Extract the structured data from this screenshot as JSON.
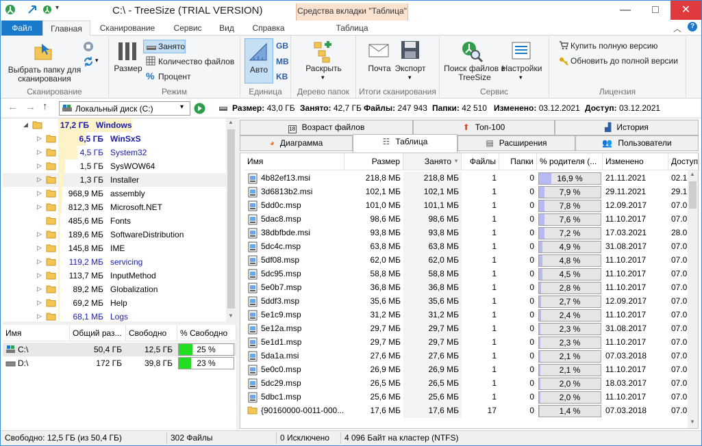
{
  "window": {
    "title": "C:\\ - TreeSize  (TRIAL VERSION)",
    "context_tab_title": "Средства вкладки \"Таблица\"",
    "minimize": "—",
    "maximize": "□",
    "close": "✕"
  },
  "ribbon_tabs": [
    "Файл",
    "Главная",
    "Сканирование",
    "Сервис",
    "Вид",
    "Справка",
    "Таблица"
  ],
  "ribbon": {
    "scan_folder": "Выбрать папку для сканирования",
    "group_scan": "Сканирование",
    "size": "Размер",
    "occupied": "Занято",
    "file_count": "Количество файлов",
    "percent": "Процент",
    "group_mode": "Режим",
    "auto": "Авто",
    "gb": "GB",
    "mb": "MB",
    "kb": "KB",
    "group_unit": "Единица",
    "expand": "Раскрыть",
    "group_tree": "Дерево папок",
    "mail": "Почта",
    "export": "Экспорт",
    "group_results": "Итоги сканирования",
    "search_files": "Поиск файлов в TreeSize",
    "settings": "Настройки",
    "group_service": "Сервис",
    "buy_full": "Купить полную версию",
    "upgrade_full": "Обновить до полной версии",
    "group_license": "Лицензия"
  },
  "address": {
    "path": "Локальный диск (C:)",
    "info": [
      {
        "label": "Размер:",
        "value": "43,0 ГБ"
      },
      {
        "label": "Занято:",
        "value": "42,7 ГБ"
      },
      {
        "label": "Файлы:",
        "value": "247 943"
      },
      {
        "label": "Папки:",
        "value": "42 510"
      },
      {
        "label": "Изменено:",
        "value": "03.12.2021"
      },
      {
        "label": "Доступ:",
        "value": "03.12.2021"
      }
    ]
  },
  "tree": [
    {
      "size": "17,2 ГБ",
      "name": "Windows",
      "level": 0,
      "bold": true,
      "expanded": true,
      "blue": true,
      "bar": 1.0
    },
    {
      "size": "6,5 ГБ",
      "name": "WinSxS",
      "level": 1,
      "bold": true,
      "blue": true,
      "bar": 0.38
    },
    {
      "size": "4,5 ГБ",
      "name": "System32",
      "level": 1,
      "blue": true,
      "bar": 0.26
    },
    {
      "size": "1,5 ГБ",
      "name": "SysWOW64",
      "level": 1,
      "bar": 0.09
    },
    {
      "size": "1,3 ГБ",
      "name": "Installer",
      "level": 1,
      "bar": 0.08,
      "selected": true
    },
    {
      "size": "968,9 МБ",
      "name": "assembly",
      "level": 1,
      "bar": 0.055
    },
    {
      "size": "812,3 МБ",
      "name": "Microsoft.NET",
      "level": 1,
      "bar": 0.046
    },
    {
      "size": "485,6 МБ",
      "name": "Fonts",
      "level": 1,
      "bar": 0.028,
      "nochild": true
    },
    {
      "size": "189,6 МБ",
      "name": "SoftwareDistribution",
      "level": 1,
      "bar": 0.011
    },
    {
      "size": "145,8 МБ",
      "name": "IME",
      "level": 1,
      "bar": 0.008
    },
    {
      "size": "119,2 МБ",
      "name": "servicing",
      "level": 1,
      "blue": true,
      "bar": 0.007
    },
    {
      "size": "113,7 МБ",
      "name": "InputMethod",
      "level": 1,
      "bar": 0.006
    },
    {
      "size": "89,2 МБ",
      "name": "Globalization",
      "level": 1,
      "bar": 0.005
    },
    {
      "size": "69,2 МБ",
      "name": "Help",
      "level": 1,
      "bar": 0.004
    },
    {
      "size": "68,1 МБ",
      "name": "Logs",
      "level": 1,
      "blue": true,
      "bar": 0.004
    }
  ],
  "drives": {
    "headers": [
      "Имя",
      "Общий раз...",
      "Свободно",
      "% Свободно"
    ],
    "rows": [
      {
        "name": "C:\\",
        "total": "50,4 ГБ",
        "free": "12,5 ГБ",
        "pct_label": "25 %",
        "pct": 0.25
      },
      {
        "name": "D:\\",
        "total": "172 ГБ",
        "free": "39,8 ГБ",
        "pct_label": "23 %",
        "pct": 0.23
      }
    ]
  },
  "content_tabs": {
    "row1": [
      "Возраст файлов",
      "Топ-100",
      "История"
    ],
    "row2": [
      "Диаграмма",
      "Таблица",
      "Расширения",
      "Пользователи"
    ]
  },
  "table": {
    "headers": [
      "Имя",
      "Размер",
      "Занято",
      "Файлы",
      "Папки",
      "% родителя (...",
      "Изменено",
      "Доступ"
    ],
    "rows": [
      {
        "name": "4b82ef13.msi",
        "size": "218,8 МБ",
        "alloc": "218,8 МБ",
        "files": "1",
        "folders": "0",
        "pct_label": "16,9 %",
        "pct": 0.169,
        "modified": "21.11.2021",
        "access": "02.1"
      },
      {
        "name": "3d6813b2.msi",
        "size": "102,1 МБ",
        "alloc": "102,1 МБ",
        "files": "1",
        "folders": "0",
        "pct_label": "7,9 %",
        "pct": 0.079,
        "modified": "29.11.2021",
        "access": "29.1"
      },
      {
        "name": "5dd0c.msp",
        "size": "101,0 МБ",
        "alloc": "101,1 МБ",
        "files": "1",
        "folders": "0",
        "pct_label": "7,8 %",
        "pct": 0.078,
        "modified": "12.09.2017",
        "access": "07.0"
      },
      {
        "name": "5dac8.msp",
        "size": "98,6 МБ",
        "alloc": "98,6 МБ",
        "files": "1",
        "folders": "0",
        "pct_label": "7,6 %",
        "pct": 0.076,
        "modified": "11.10.2017",
        "access": "07.0"
      },
      {
        "name": "38dbfbde.msi",
        "size": "93,8 МБ",
        "alloc": "93,8 МБ",
        "files": "1",
        "folders": "0",
        "pct_label": "7,2 %",
        "pct": 0.072,
        "modified": "17.03.2021",
        "access": "28.0"
      },
      {
        "name": "5dc4c.msp",
        "size": "63,8 МБ",
        "alloc": "63,8 МБ",
        "files": "1",
        "folders": "0",
        "pct_label": "4,9 %",
        "pct": 0.049,
        "modified": "31.08.2017",
        "access": "07.0"
      },
      {
        "name": "5df08.msp",
        "size": "62,0 МБ",
        "alloc": "62,0 МБ",
        "files": "1",
        "folders": "0",
        "pct_label": "4,8 %",
        "pct": 0.048,
        "modified": "11.10.2017",
        "access": "07.0"
      },
      {
        "name": "5dc95.msp",
        "size": "58,8 МБ",
        "alloc": "58,8 МБ",
        "files": "1",
        "folders": "0",
        "pct_label": "4,5 %",
        "pct": 0.045,
        "modified": "11.10.2017",
        "access": "07.0"
      },
      {
        "name": "5e0b7.msp",
        "size": "36,8 МБ",
        "alloc": "36,8 МБ",
        "files": "1",
        "folders": "0",
        "pct_label": "2,8 %",
        "pct": 0.028,
        "modified": "11.10.2017",
        "access": "07.0"
      },
      {
        "name": "5ddf3.msp",
        "size": "35,6 МБ",
        "alloc": "35,6 МБ",
        "files": "1",
        "folders": "0",
        "pct_label": "2,7 %",
        "pct": 0.027,
        "modified": "12.09.2017",
        "access": "07.0"
      },
      {
        "name": "5e1c9.msp",
        "size": "31,2 МБ",
        "alloc": "31,2 МБ",
        "files": "1",
        "folders": "0",
        "pct_label": "2,4 %",
        "pct": 0.024,
        "modified": "11.10.2017",
        "access": "07.0"
      },
      {
        "name": "5e12a.msp",
        "size": "29,7 МБ",
        "alloc": "29,7 МБ",
        "files": "1",
        "folders": "0",
        "pct_label": "2,3 %",
        "pct": 0.023,
        "modified": "31.08.2017",
        "access": "07.0"
      },
      {
        "name": "5e1d1.msp",
        "size": "29,7 МБ",
        "alloc": "29,7 МБ",
        "files": "1",
        "folders": "0",
        "pct_label": "2,3 %",
        "pct": 0.023,
        "modified": "11.10.2017",
        "access": "07.0"
      },
      {
        "name": "5da1a.msi",
        "size": "27,6 МБ",
        "alloc": "27,6 МБ",
        "files": "1",
        "folders": "0",
        "pct_label": "2,1 %",
        "pct": 0.021,
        "modified": "07.03.2018",
        "access": "07.0"
      },
      {
        "name": "5e0c0.msp",
        "size": "26,9 МБ",
        "alloc": "26,9 МБ",
        "files": "1",
        "folders": "0",
        "pct_label": "2,1 %",
        "pct": 0.021,
        "modified": "11.10.2017",
        "access": "07.0"
      },
      {
        "name": "5dc29.msp",
        "size": "26,5 МБ",
        "alloc": "26,5 МБ",
        "files": "1",
        "folders": "0",
        "pct_label": "2,0 %",
        "pct": 0.02,
        "modified": "18.03.2017",
        "access": "07.0"
      },
      {
        "name": "5dbc1.msp",
        "size": "25,6 МБ",
        "alloc": "25,6 МБ",
        "files": "1",
        "folders": "0",
        "pct_label": "2,0 %",
        "pct": 0.02,
        "modified": "11.10.2017",
        "access": "07.0"
      },
      {
        "name": "{90160000-0011-000...",
        "size": "17,6 МБ",
        "alloc": "17,6 МБ",
        "files": "17",
        "folders": "0",
        "pct_label": "1,4 %",
        "pct": 0.014,
        "modified": "07.03.2018",
        "access": "07.0",
        "folder": true
      }
    ]
  },
  "status": {
    "free": "Свободно: 12,5 ГБ  (из 50,4 ГБ)",
    "files": "302 Файлы",
    "excluded": "0 Исключено",
    "cluster": "4 096 Байт на кластер (NTFS)"
  },
  "colors": {
    "accent": "#1979ca",
    "tree_bar": "#fdf3c9",
    "pct_fill": "#b7b9f2",
    "free_green": "#22dd22",
    "link_blue": "#1a1aa6"
  }
}
